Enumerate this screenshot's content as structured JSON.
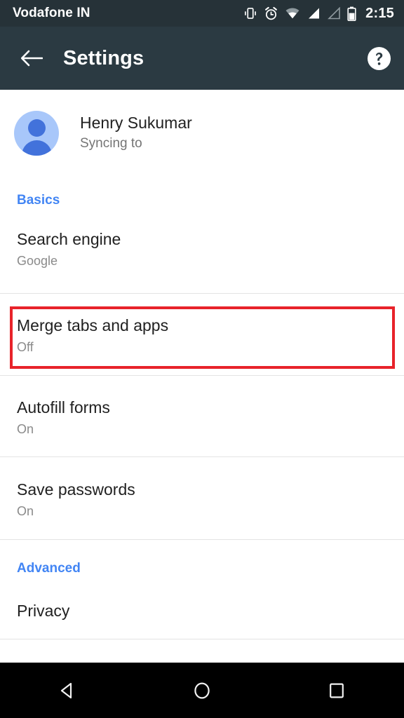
{
  "status_bar": {
    "carrier": "Vodafone IN",
    "time": "2:15",
    "icons": [
      "vibrate-icon",
      "alarm-icon",
      "wifi-icon",
      "signal-icon",
      "signal-empty-icon",
      "battery-icon"
    ]
  },
  "app_bar": {
    "back_icon": "back-arrow-icon",
    "title": "Settings",
    "help_icon": "help-icon"
  },
  "account": {
    "avatar_icon": "person-avatar-icon",
    "name": "Henry Sukumar",
    "status": "Syncing to"
  },
  "sections": [
    {
      "header": "Basics",
      "items": [
        {
          "title": "Search engine",
          "subtitle": "Google",
          "highlighted": false
        },
        {
          "title": "Merge tabs and apps",
          "subtitle": "Off",
          "highlighted": true
        },
        {
          "title": "Autofill forms",
          "subtitle": "On",
          "highlighted": false
        },
        {
          "title": "Save passwords",
          "subtitle": "On",
          "highlighted": false
        }
      ]
    },
    {
      "header": "Advanced",
      "items": [
        {
          "title": "Privacy",
          "subtitle": "",
          "highlighted": false
        }
      ]
    }
  ],
  "nav_bar": {
    "back": "nav-back-icon",
    "home": "nav-home-icon",
    "recents": "nav-recents-icon"
  },
  "colors": {
    "status_bar_bg": "#263238",
    "app_bar_bg": "#2b3a42",
    "accent_blue": "#4285f4",
    "highlight_red": "#e8232a",
    "avatar_bg": "#a8c7fa",
    "avatar_fg": "#4272db"
  }
}
